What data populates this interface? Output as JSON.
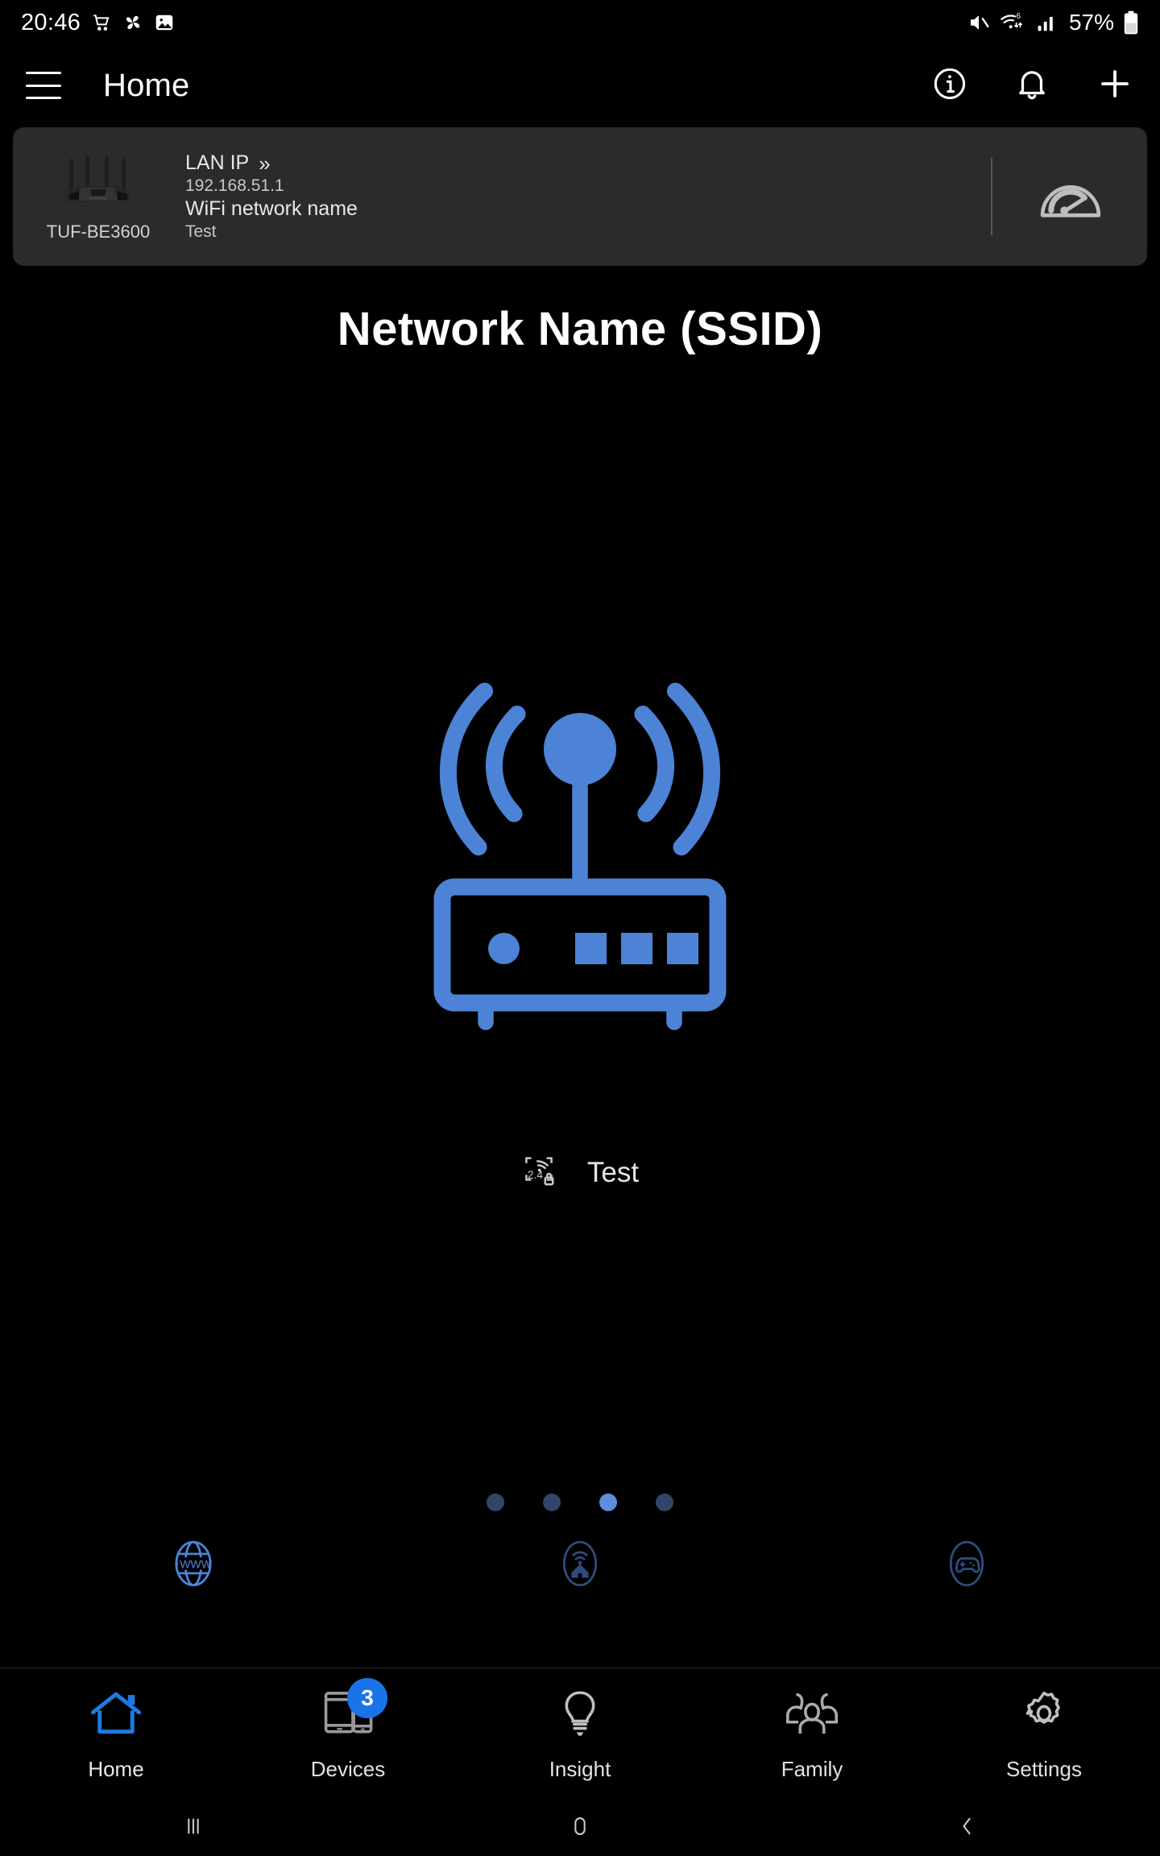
{
  "status_bar": {
    "time": "20:46",
    "left_icons": [
      "shopping-cart-icon",
      "pinwheel-icon",
      "photo-icon"
    ],
    "right_icons": [
      "mute-icon",
      "wifi-6-icon",
      "cellular-signal-icon"
    ],
    "battery_percent": "57%"
  },
  "app_bar": {
    "menu_icon": "hamburger-menu-icon",
    "title": "Home",
    "actions": [
      {
        "name": "info-icon",
        "label": "i"
      },
      {
        "name": "notification-bell-icon",
        "label": ""
      },
      {
        "name": "add-icon",
        "label": "+"
      }
    ]
  },
  "router_card": {
    "model": "TUF-BE3600",
    "lan_ip_label": "LAN IP",
    "lan_ip_chevron": "»",
    "lan_ip_value": "192.168.51.1",
    "wifi_name_label": "WiFi network name",
    "wifi_name_value": "Test",
    "speed_test_icon": "speedometer-icon"
  },
  "main": {
    "title": "Network Name (SSID)",
    "router_illustration": "wifi-router-icon",
    "band_badge": "2.4",
    "ssid": "Test",
    "lock_icon": "lock-icon"
  },
  "pager": {
    "total": 4,
    "active_index": 2
  },
  "shortcuts": [
    {
      "name": "internet-globe-icon",
      "label": "WWW",
      "active": true
    },
    {
      "name": "home-wifi-icon",
      "label": "",
      "active": false
    },
    {
      "name": "game-controller-icon",
      "label": "",
      "active": false
    }
  ],
  "bottom_nav": {
    "items": [
      {
        "name": "home",
        "label": "Home",
        "icon": "home-icon",
        "active": true,
        "badge": null
      },
      {
        "name": "devices",
        "label": "Devices",
        "icon": "devices-icon",
        "active": false,
        "badge": "3"
      },
      {
        "name": "insight",
        "label": "Insight",
        "icon": "lightbulb-icon",
        "active": false,
        "badge": null
      },
      {
        "name": "family",
        "label": "Family",
        "icon": "people-icon",
        "active": false,
        "badge": null
      },
      {
        "name": "settings",
        "label": "Settings",
        "icon": "gear-icon",
        "active": false,
        "badge": null
      }
    ]
  },
  "system_nav": {
    "recents": "recents-icon",
    "home": "system-home-icon",
    "back": "back-icon"
  },
  "colors": {
    "accent_blue": "#4d83d6",
    "badge_blue": "#1a73e8",
    "card_bg": "#2b2b2b",
    "dot_inactive": "#2f4668",
    "dot_active": "#5b8fdd",
    "background": "#000000"
  }
}
